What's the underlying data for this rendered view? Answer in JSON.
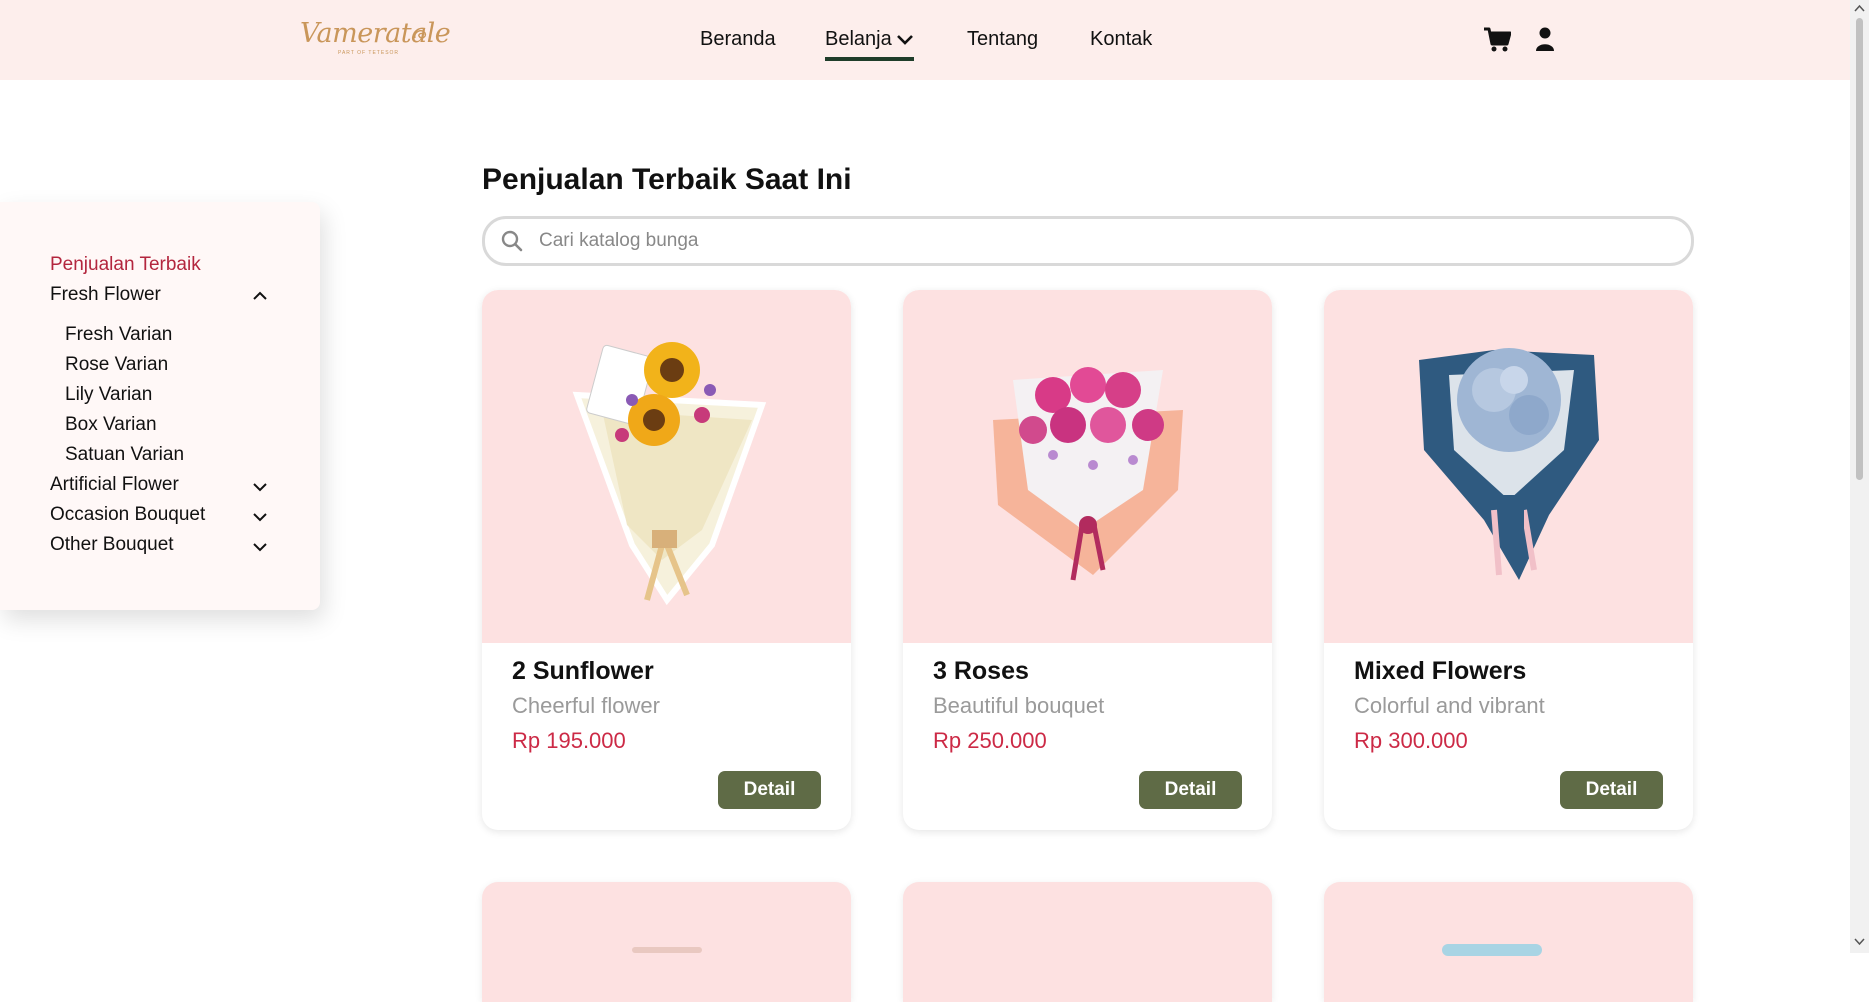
{
  "header": {
    "logo_text": "Vameratale",
    "logo_sub": "PART OF TETESOR",
    "nav": {
      "home": "Beranda",
      "shop": "Belanja",
      "about": "Tentang",
      "contact": "Kontak"
    },
    "icons": {
      "cart": "cart-icon",
      "user": "user-icon"
    }
  },
  "sidebar": {
    "best_seller": "Penjualan Terbaik",
    "fresh_flower": "Fresh Flower",
    "fresh_sub": [
      "Fresh Varian",
      "Rose Varian",
      "Lily Varian",
      "Box Varian",
      "Satuan Varian"
    ],
    "artificial_flower": "Artificial Flower",
    "occasion_bouquet": "Occasion Bouquet",
    "other_bouquet": "Other Bouquet"
  },
  "main": {
    "title": "Penjualan Terbaik Saat Ini",
    "search_placeholder": "Cari katalog bunga",
    "products": [
      {
        "name": "2 Sunflower",
        "desc": "Cheerful flower",
        "price": "Rp 195.000",
        "button": "Detail"
      },
      {
        "name": "3 Roses",
        "desc": "Beautiful bouquet",
        "price": "Rp 250.000",
        "button": "Detail"
      },
      {
        "name": "Mixed Flowers",
        "desc": "Colorful and vibrant",
        "price": "Rp 300.000",
        "button": "Detail"
      }
    ]
  },
  "colors": {
    "header_bg": "#fdeeec",
    "accent_red": "#cc2a46",
    "button_green": "#5f6b46",
    "card_img_bg": "#fde1e1",
    "active_underline": "#1f3d2a"
  }
}
